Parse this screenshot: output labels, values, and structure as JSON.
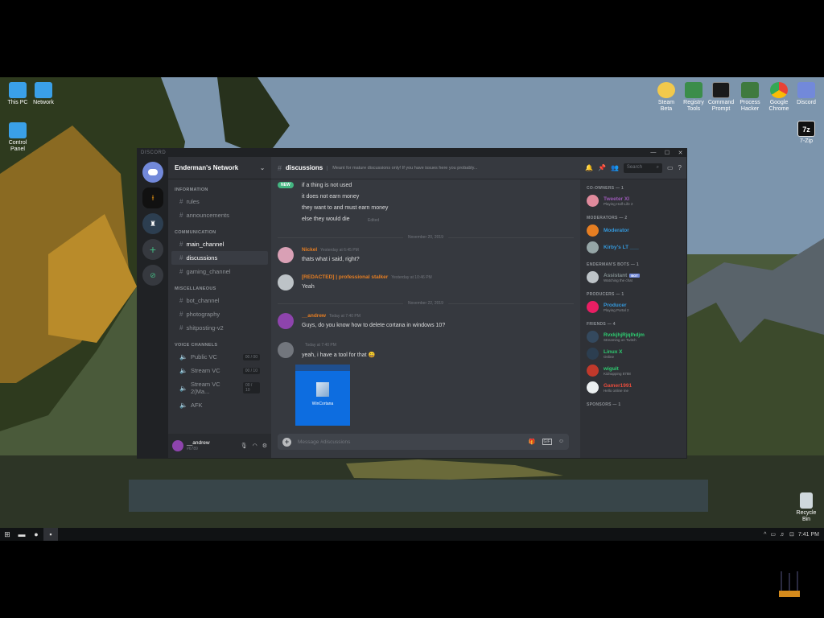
{
  "desktop": {
    "icons_left": [
      {
        "label": "This PC",
        "icon": "computer-icon",
        "color": "#3aa0e8"
      },
      {
        "label": "Network",
        "icon": "network-icon",
        "color": "#3aa0e8"
      },
      {
        "label": "Control Panel",
        "icon": "control-panel-icon",
        "color": "#3aa0e8"
      }
    ],
    "icons_right": [
      {
        "label": "Steam Beta",
        "icon": "steam-icon",
        "color": "#f2c94c"
      },
      {
        "label": "Registry Tools",
        "icon": "registry-icon",
        "color": "#3b8d4a"
      },
      {
        "label": "Command Prompt",
        "icon": "cmd-icon",
        "color": "#1a1a1a"
      },
      {
        "label": "Process Hacker",
        "icon": "process-icon",
        "color": "#3f7a3f"
      },
      {
        "label": "Google Chrome",
        "icon": "chrome-icon",
        "color": "#e94235"
      },
      {
        "label": "Discord",
        "icon": "discord-icon",
        "color": "#7289da"
      }
    ],
    "icon_7zip": {
      "label": "7-Zip",
      "glyph": "7z"
    },
    "recycle_bin": {
      "label": "Recycle Bin"
    }
  },
  "taskbar": {
    "clock": "7:41 PM",
    "tray_glyphs": [
      "^",
      "▭",
      "♬",
      "⊡"
    ]
  },
  "window": {
    "title": "DISCORD",
    "controls": [
      "—",
      "☐",
      "✕"
    ]
  },
  "server": {
    "name": "Enderman's Network",
    "categories": [
      {
        "name": "INFORMATION",
        "channels": [
          {
            "name": "rules",
            "state": "normal"
          },
          {
            "name": "announcements",
            "state": "normal"
          }
        ]
      },
      {
        "name": "COMMUNICATION",
        "channels": [
          {
            "name": "main_channel",
            "state": "unread"
          },
          {
            "name": "discussions",
            "state": "active"
          },
          {
            "name": "gaming_channel",
            "state": "normal"
          }
        ]
      },
      {
        "name": "MISCELLANEOUS",
        "channels": [
          {
            "name": "bot_channel",
            "state": "normal"
          },
          {
            "name": "photography",
            "state": "normal"
          },
          {
            "name": "shitposting-v2",
            "state": "normal"
          }
        ]
      },
      {
        "name": "VOICE CHANNELS",
        "channels": [
          {
            "name": "Public VC",
            "state": "voice",
            "count": "00 / 00"
          },
          {
            "name": "Stream VC",
            "state": "voice",
            "count": "00 / 10"
          },
          {
            "name": "Stream VC 2(Ma...",
            "state": "voice",
            "count": "00 / 10"
          },
          {
            "name": "AFK",
            "state": "voice",
            "count": ""
          }
        ]
      }
    ]
  },
  "user": {
    "name": "__andrew",
    "tag": "#6789"
  },
  "chat": {
    "channel": "discussions",
    "topic": "Meant for mature discussions only! If you have issues here you probably...",
    "search_placeholder": "Search",
    "composer_placeholder": "Message #discussions",
    "new_badge": "NEW",
    "early_lines": [
      "if a thing is not used",
      "it does not earn money",
      "they want to and must earn money",
      "else they would die"
    ],
    "early_last_ts": "Edited",
    "dividers": [
      "November 20, 2019",
      "November 22, 2019"
    ],
    "messages": [
      {
        "author": "Nickel",
        "color": "#e67e22",
        "ts": "Yesterday at 6:45 PM",
        "text": "thats what i said, right?"
      },
      {
        "author": "[REDACTED] | professional stalker",
        "color": "#e67e22",
        "ts": "Yesterday at 10:46 PM",
        "text": "Yeah"
      },
      {
        "author": "__andrew",
        "color": "#e67e22",
        "ts": "Today at 7:40 PM",
        "text": "Guys, do you know how to delete cortana in windows 10?"
      },
      {
        "author": "",
        "color": "#72767d",
        "ts": "Today at 7:40 PM",
        "text": "yeah, i have a tool for that 😄"
      }
    ],
    "image_caption": "WinCortana"
  },
  "members": {
    "groups": [
      {
        "role": "CO-OWNERS — 1",
        "list": [
          {
            "name": "Tweeter XI",
            "color": "#9b59b6",
            "status": "Playing Half-Life 2",
            "avatar": "#e08a9c"
          }
        ]
      },
      {
        "role": "MODERATORS — 2",
        "list": [
          {
            "name": "Moderator",
            "color": "#3498db",
            "status": "",
            "avatar": "#e67e22"
          },
          {
            "name": "Kirby's LT ___",
            "color": "#3498db",
            "status": "",
            "avatar": "#95a5a6"
          }
        ]
      },
      {
        "role": "ENDERMAN'S BOTS — 1",
        "list": [
          {
            "name": "Assistant",
            "color": "#7f8c8d",
            "status": "Watching the chat",
            "avatar": "#bdc3c7",
            "bot": "BOT"
          }
        ]
      },
      {
        "role": "PRODUCERS — 1",
        "list": [
          {
            "name": "Producer",
            "color": "#3498db",
            "status": "Playing Portal 2",
            "avatar": "#e91e63"
          }
        ]
      },
      {
        "role": "FRIENDS — 4",
        "list": [
          {
            "name": "RvxkjhjRjqlhdjm",
            "color": "#2ecc71",
            "status": "Streaming on Twitch",
            "avatar": "#34495e"
          },
          {
            "name": "Linux X",
            "color": "#2ecc71",
            "status": "Online",
            "avatar": "#2c3e50"
          },
          {
            "name": "wiguit",
            "color": "#2ecc71",
            "status": "Kidnapping 8788",
            "avatar": "#c0392b"
          },
          {
            "name": "Gamer1991",
            "color": "#e74c3c",
            "status": "Hello online me",
            "avatar": "#ecf0f1"
          }
        ]
      },
      {
        "role": "SPONSORS — 1",
        "list": []
      }
    ]
  }
}
